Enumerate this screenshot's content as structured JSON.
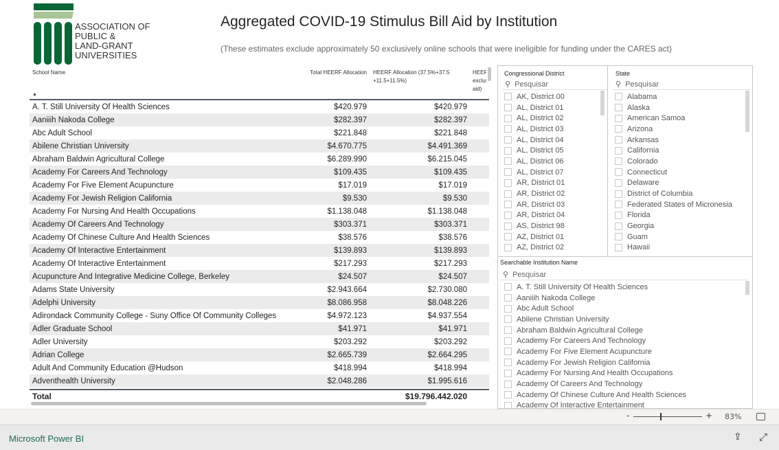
{
  "logo": {
    "lines": [
      "ASSOCIATION OF",
      "PUBLIC &",
      "LAND-GRANT",
      "UNIVERSITIES"
    ],
    "colors": {
      "dark": "#0b6636",
      "light": "#a7c496"
    }
  },
  "title": "Aggregated COVID-19 Stimulus Bill Aid by Institution",
  "subtitle": "(These estimates exclude approximately 50 exclusively online schools that were ineligible for funding under the CARES act)",
  "table": {
    "headers": [
      "School Name",
      "Total HEERF Allocation",
      "HEERF Allocation (37.5%+37.5 +11.5+11.5%)",
      "HEERF exclus aid)"
    ],
    "sort_indicator": "▲",
    "rows": [
      [
        "A. T. Still University Of Health Sciences",
        "$420.979",
        "$420.979"
      ],
      [
        "Aaniiih Nakoda College",
        "$282.397",
        "$282.397"
      ],
      [
        "Abc Adult School",
        "$221.848",
        "$221.848"
      ],
      [
        "Abilene Christian University",
        "$4.670.775",
        "$4.491.369"
      ],
      [
        "Abraham Baldwin Agricultural College",
        "$6.289.990",
        "$6.215.045"
      ],
      [
        "Academy For Careers And Technology",
        "$109.435",
        "$109.435"
      ],
      [
        "Academy For Five Element Acupuncture",
        "$17.019",
        "$17.019"
      ],
      [
        "Academy For Jewish Religion California",
        "$9.530",
        "$9.530"
      ],
      [
        "Academy For Nursing And Health Occupations",
        "$1.138.048",
        "$1.138.048"
      ],
      [
        "Academy Of Careers And Technology",
        "$303.371",
        "$303.371"
      ],
      [
        "Academy Of Chinese Culture And Health Sciences",
        "$38.576",
        "$38.576"
      ],
      [
        "Academy Of Interactive Entertainment",
        "$139.893",
        "$139.893"
      ],
      [
        "Academy Of Interactive Entertainment",
        "$217.293",
        "$217.293"
      ],
      [
        "Acupuncture And Integrative Medicine College, Berkeley",
        "$24.507",
        "$24.507"
      ],
      [
        "Adams State University",
        "$2.943.664",
        "$2.730.080"
      ],
      [
        "Adelphi University",
        "$8.086.958",
        "$8.048.226"
      ],
      [
        "Adirondack Community College - Suny Office Of Community Colleges",
        "$4.972.123",
        "$4.937.554"
      ],
      [
        "Adler Graduate School",
        "$41.971",
        "$41.971"
      ],
      [
        "Adler University",
        "$203.292",
        "$203.292"
      ],
      [
        "Adrian College",
        "$2.665.739",
        "$2.664.295"
      ],
      [
        "Adult And Community Education @Hudson",
        "$418.994",
        "$418.994"
      ],
      [
        "Adventhealth University",
        "$2.048.286",
        "$1.995.616"
      ]
    ],
    "total_label": "Total",
    "total_value": "$19.796.442.020"
  },
  "slicers": {
    "district": {
      "title": "Congressional District",
      "search_placeholder": "Pesquisar",
      "items": [
        "AK, District 00",
        "AL, District 01",
        "AL, District 02",
        "AL, District 03",
        "AL, District 04",
        "AL, District 05",
        "AL, District 06",
        "AL, District 07",
        "AR, District 01",
        "AR, District 02",
        "AR, District 03",
        "AR, District 04",
        "AS, District 98",
        "AZ, District 01",
        "AZ, District 02"
      ]
    },
    "state": {
      "title": "State",
      "search_placeholder": "Pesquisar",
      "items": [
        "Alabama",
        "Alaska",
        "American Samoa",
        "Arizona",
        "Arkansas",
        "California",
        "Colorado",
        "Connecticut",
        "Delaware",
        "District of Columbia",
        "Federated States of Micronesia",
        "Florida",
        "Georgia",
        "Guam",
        "Hawaii"
      ]
    },
    "institution": {
      "title": "Searchable Institution Name",
      "search_placeholder": "Pesquisar",
      "items": [
        "A. T. Still University Of Health Sciences",
        "Aaniiih Nakoda College",
        "Abc Adult School",
        "Abilene Christian University",
        "Abraham Baldwin Agricultural College",
        "Academy For Careers And Technology",
        "Academy For Five Element Acupuncture",
        "Academy For Jewish Religion California",
        "Academy For Nursing And Health Occupations",
        "Academy Of Careers And Technology",
        "Academy Of Chinese Culture And Health Sciences",
        "Academy Of Interactive Entertainment"
      ]
    }
  },
  "zoom": {
    "minus": "-",
    "plus": "+",
    "level": "83%",
    "level_percent": 83
  },
  "footer": {
    "link": "Microsoft Power BI",
    "share_icon": "share-icon",
    "expand_icon": "expand-icon"
  }
}
